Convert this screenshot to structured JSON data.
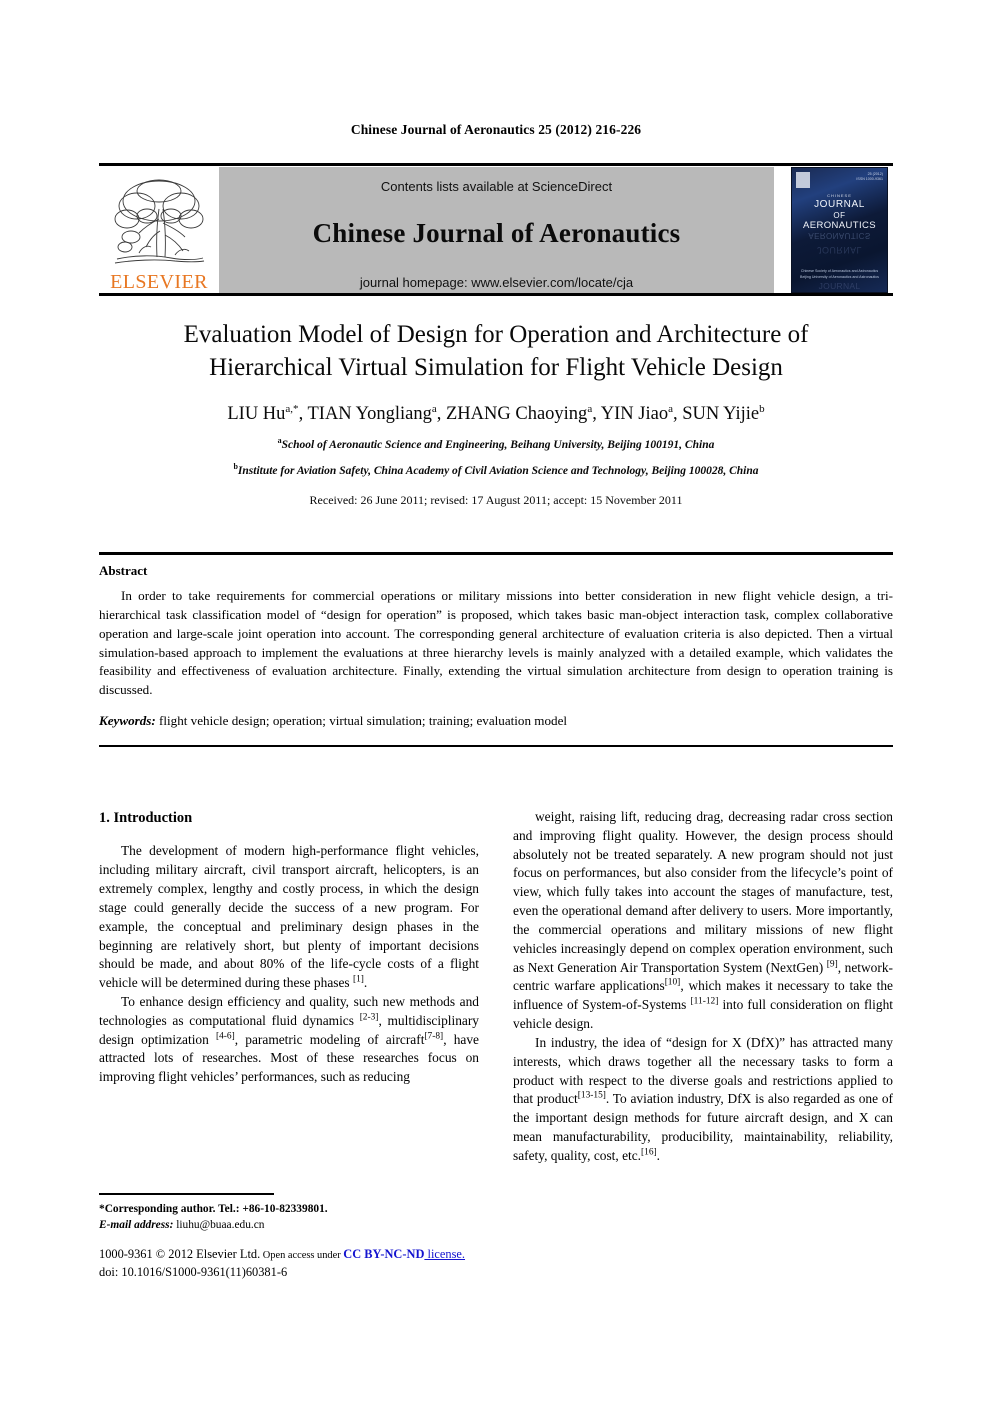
{
  "running_head": "Chinese Journal of Aeronautics 25 (2012) 216-226",
  "masthead": {
    "publisher_name": "ELSEVIER",
    "contents_line": "Contents lists available at ScienceDirect",
    "journal_name": "Chinese Journal of Aeronautics",
    "homepage_line": "journal homepage: www.elsevier.com/locate/cja",
    "cover": {
      "issue_line_1": "25 (2012)",
      "issue_line_2": "ISSN 1000-9361",
      "kicker": "CHINESE",
      "title_line_1": "JOURNAL",
      "title_line_2": "OF",
      "title_line_3": "AERONAUTICS",
      "society_line_1": "Chinese Society of Aeronautics and Astronautics",
      "society_line_2": "Beijing University of Aeronautics and Astronautics"
    }
  },
  "article": {
    "title_line_1": "Evaluation Model of Design for Operation and Architecture of",
    "title_line_2": "Hierarchical Virtual Simulation for Flight Vehicle Design",
    "authors": "LIU Hu, TIAN Yongliang, ZHANG Chaoying, YIN Jiao, SUN Yijie",
    "authors_html": "LIU Hu<sup>a,*</sup>, TIAN Yongliang<sup>a</sup>, ZHANG Chaoying<sup>a</sup>, YIN Jiao<sup>a</sup>, SUN Yijie<sup>b</sup>",
    "affiliation_a": "School of Aeronautic Science and Engineering, Beihang University, Beijing 100191, China",
    "affiliation_a_marker": "a",
    "affiliation_b": "Institute for Aviation Safety, China Academy of Civil Aviation Science and Technology, Beijing 100028, China",
    "affiliation_b_marker": "b",
    "dates": "Received: 26 June 2011; revised: 17 August 2011; accept: 15 November 2011"
  },
  "abstract": {
    "heading": "Abstract",
    "text": "In order to take requirements for commercial operations or military missions into better consideration in new flight vehicle design, a tri-hierarchical task classification model of “design for operation” is proposed, which takes basic man-object interaction task, complex collaborative operation and large-scale joint operation into account. The corresponding general architecture of evaluation criteria is also depicted. Then a virtual simulation-based approach to implement the evaluations at three hierarchy levels is mainly analyzed with a detailed example, which validates the feasibility and effectiveness of evaluation architecture. Finally, extending the virtual simulation architecture from design to operation training is discussed.",
    "keywords_label": "Keywords:",
    "keywords_text": " flight vehicle design; operation; virtual simulation; training; evaluation model"
  },
  "body": {
    "section_heading": "1.  Introduction",
    "left_paragraphs": [
      "The development of modern high-performance flight vehicles, including military aircraft, civil transport aircraft, helicopters, is an extremely complex, lengthy and costly process, in which the design stage could generally decide the success of a new program. For example, the conceptual and preliminary design phases in the beginning are relatively short, but plenty of important decisions should be made, and about 80% of the life-cycle costs of a flight vehicle will be determined during these phases [1].",
      "To enhance design efficiency and quality, such new methods and technologies as computational fluid dynamics [2-3], multidisciplinary design optimization [4-6], parametric modeling of aircraft[7-8], have attracted lots of researches. Most of these researches focus on improving flight vehicles’ performances, such as reducing"
    ],
    "right_paragraphs": [
      "weight, raising lift, reducing drag, decreasing radar cross section and improving flight quality. However, the design process should absolutely not be treated separately. A new program should not just focus on performances, but also consider from the lifecycle’s point of view, which fully takes into account the stages of manufacture, test, even the operational demand after delivery to users. More importantly, the commercial operations and military missions of new flight vehicles increasingly depend on complex operation environment, such as Next Generation Air Transportation System (NextGen) [9], network-centric warfare applications[10], which makes it necessary to take the influence of System-of-Systems [11-12] into full consideration on flight vehicle design.",
      "In industry, the idea of “design for X (DfX)” has attracted many interests, which draws together all the necessary tasks to form a product with respect to the diverse goals and restrictions applied to that product[13-15]. To aviation industry, DfX is also regarded as one of the important design methods for future aircraft design, and X can mean manufacturability, producibility, maintainability, reliability, safety, quality, cost, etc.[16]."
    ]
  },
  "footnote": {
    "corresponding": "*Corresponding author. Tel.: +86-10-82339801.",
    "email_label": "E-mail address:",
    "email": " liuhu@buaa.edu.cn",
    "copyright": "1000-9361 © 2012 Elsevier Ltd.",
    "open_access": " Open access under ",
    "license": "CC BY-NC-ND",
    "license_tail": " license.",
    "doi": "doi: 10.1016/S1000-9361(11)60381-6"
  },
  "colors": {
    "elsevier_orange": "#e87722",
    "masthead_gray": "#b9b9b9",
    "license_blue": "#1414cf",
    "cover_blue": "#22407e"
  }
}
